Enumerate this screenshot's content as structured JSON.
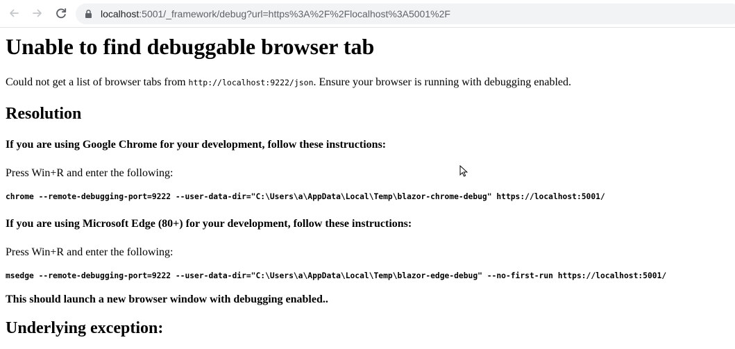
{
  "browser": {
    "back_icon": "arrow-left-icon",
    "forward_icon": "arrow-right-icon",
    "reload_icon": "reload-icon",
    "url_host": "localhost",
    "url_rest": ":5001/_framework/debug?url=https%3A%2F%2Flocalhost%3A5001%2F"
  },
  "page": {
    "title": "Unable to find debuggable browser tab",
    "intro_before": "Could not get a list of browser tabs from ",
    "intro_code": "http://localhost:9222/json",
    "intro_after": ". Ensure your browser is running with debugging enabled.",
    "resolution_heading": "Resolution",
    "chrome_heading": "If you are using Google Chrome for your development, follow these instructions:",
    "chrome_press": "Press Win+R and enter the following:",
    "chrome_command": "chrome --remote-debugging-port=9222 --user-data-dir=\"C:\\Users\\a\\AppData\\Local\\Temp\\blazor-chrome-debug\" https://localhost:5001/",
    "edge_heading": "If you are using Microsoft Edge (80+) for your development, follow these instructions:",
    "edge_press": "Press Win+R and enter the following:",
    "edge_command": "msedge --remote-debugging-port=9222 --user-data-dir=\"C:\\Users\\a\\AppData\\Local\\Temp\\blazor-edge-debug\" --no-first-run https://localhost:5001/",
    "launch_note": "This should launch a new browser window with debugging enabled..",
    "exception_heading": "Underlying exception:"
  }
}
